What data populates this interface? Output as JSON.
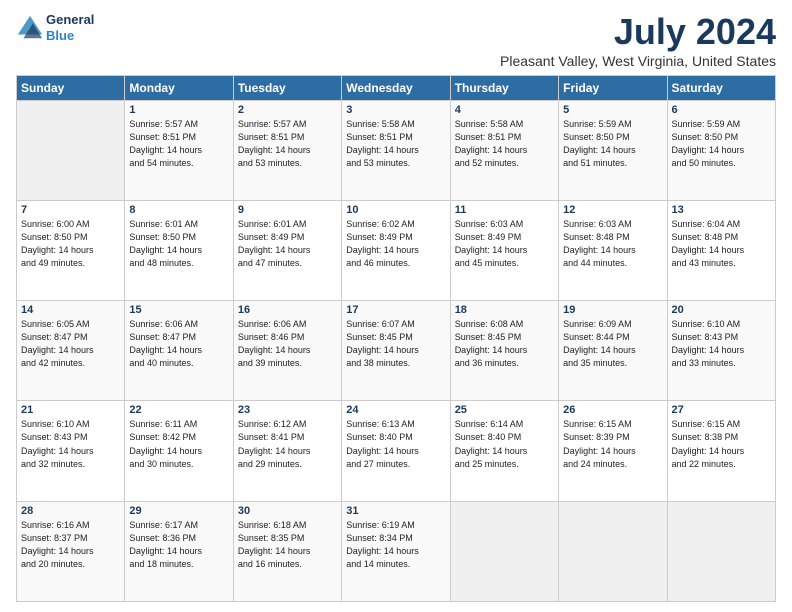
{
  "header": {
    "logo_line1": "General",
    "logo_line2": "Blue",
    "title": "July 2024",
    "subtitle": "Pleasant Valley, West Virginia, United States"
  },
  "calendar": {
    "days_of_week": [
      "Sunday",
      "Monday",
      "Tuesday",
      "Wednesday",
      "Thursday",
      "Friday",
      "Saturday"
    ],
    "weeks": [
      [
        {
          "num": "",
          "info": ""
        },
        {
          "num": "1",
          "info": "Sunrise: 5:57 AM\nSunset: 8:51 PM\nDaylight: 14 hours\nand 54 minutes."
        },
        {
          "num": "2",
          "info": "Sunrise: 5:57 AM\nSunset: 8:51 PM\nDaylight: 14 hours\nand 53 minutes."
        },
        {
          "num": "3",
          "info": "Sunrise: 5:58 AM\nSunset: 8:51 PM\nDaylight: 14 hours\nand 53 minutes."
        },
        {
          "num": "4",
          "info": "Sunrise: 5:58 AM\nSunset: 8:51 PM\nDaylight: 14 hours\nand 52 minutes."
        },
        {
          "num": "5",
          "info": "Sunrise: 5:59 AM\nSunset: 8:50 PM\nDaylight: 14 hours\nand 51 minutes."
        },
        {
          "num": "6",
          "info": "Sunrise: 5:59 AM\nSunset: 8:50 PM\nDaylight: 14 hours\nand 50 minutes."
        }
      ],
      [
        {
          "num": "7",
          "info": "Sunrise: 6:00 AM\nSunset: 8:50 PM\nDaylight: 14 hours\nand 49 minutes."
        },
        {
          "num": "8",
          "info": "Sunrise: 6:01 AM\nSunset: 8:50 PM\nDaylight: 14 hours\nand 48 minutes."
        },
        {
          "num": "9",
          "info": "Sunrise: 6:01 AM\nSunset: 8:49 PM\nDaylight: 14 hours\nand 47 minutes."
        },
        {
          "num": "10",
          "info": "Sunrise: 6:02 AM\nSunset: 8:49 PM\nDaylight: 14 hours\nand 46 minutes."
        },
        {
          "num": "11",
          "info": "Sunrise: 6:03 AM\nSunset: 8:49 PM\nDaylight: 14 hours\nand 45 minutes."
        },
        {
          "num": "12",
          "info": "Sunrise: 6:03 AM\nSunset: 8:48 PM\nDaylight: 14 hours\nand 44 minutes."
        },
        {
          "num": "13",
          "info": "Sunrise: 6:04 AM\nSunset: 8:48 PM\nDaylight: 14 hours\nand 43 minutes."
        }
      ],
      [
        {
          "num": "14",
          "info": "Sunrise: 6:05 AM\nSunset: 8:47 PM\nDaylight: 14 hours\nand 42 minutes."
        },
        {
          "num": "15",
          "info": "Sunrise: 6:06 AM\nSunset: 8:47 PM\nDaylight: 14 hours\nand 40 minutes."
        },
        {
          "num": "16",
          "info": "Sunrise: 6:06 AM\nSunset: 8:46 PM\nDaylight: 14 hours\nand 39 minutes."
        },
        {
          "num": "17",
          "info": "Sunrise: 6:07 AM\nSunset: 8:45 PM\nDaylight: 14 hours\nand 38 minutes."
        },
        {
          "num": "18",
          "info": "Sunrise: 6:08 AM\nSunset: 8:45 PM\nDaylight: 14 hours\nand 36 minutes."
        },
        {
          "num": "19",
          "info": "Sunrise: 6:09 AM\nSunset: 8:44 PM\nDaylight: 14 hours\nand 35 minutes."
        },
        {
          "num": "20",
          "info": "Sunrise: 6:10 AM\nSunset: 8:43 PM\nDaylight: 14 hours\nand 33 minutes."
        }
      ],
      [
        {
          "num": "21",
          "info": "Sunrise: 6:10 AM\nSunset: 8:43 PM\nDaylight: 14 hours\nand 32 minutes."
        },
        {
          "num": "22",
          "info": "Sunrise: 6:11 AM\nSunset: 8:42 PM\nDaylight: 14 hours\nand 30 minutes."
        },
        {
          "num": "23",
          "info": "Sunrise: 6:12 AM\nSunset: 8:41 PM\nDaylight: 14 hours\nand 29 minutes."
        },
        {
          "num": "24",
          "info": "Sunrise: 6:13 AM\nSunset: 8:40 PM\nDaylight: 14 hours\nand 27 minutes."
        },
        {
          "num": "25",
          "info": "Sunrise: 6:14 AM\nSunset: 8:40 PM\nDaylight: 14 hours\nand 25 minutes."
        },
        {
          "num": "26",
          "info": "Sunrise: 6:15 AM\nSunset: 8:39 PM\nDaylight: 14 hours\nand 24 minutes."
        },
        {
          "num": "27",
          "info": "Sunrise: 6:15 AM\nSunset: 8:38 PM\nDaylight: 14 hours\nand 22 minutes."
        }
      ],
      [
        {
          "num": "28",
          "info": "Sunrise: 6:16 AM\nSunset: 8:37 PM\nDaylight: 14 hours\nand 20 minutes."
        },
        {
          "num": "29",
          "info": "Sunrise: 6:17 AM\nSunset: 8:36 PM\nDaylight: 14 hours\nand 18 minutes."
        },
        {
          "num": "30",
          "info": "Sunrise: 6:18 AM\nSunset: 8:35 PM\nDaylight: 14 hours\nand 16 minutes."
        },
        {
          "num": "31",
          "info": "Sunrise: 6:19 AM\nSunset: 8:34 PM\nDaylight: 14 hours\nand 14 minutes."
        },
        {
          "num": "",
          "info": ""
        },
        {
          "num": "",
          "info": ""
        },
        {
          "num": "",
          "info": ""
        }
      ]
    ]
  }
}
